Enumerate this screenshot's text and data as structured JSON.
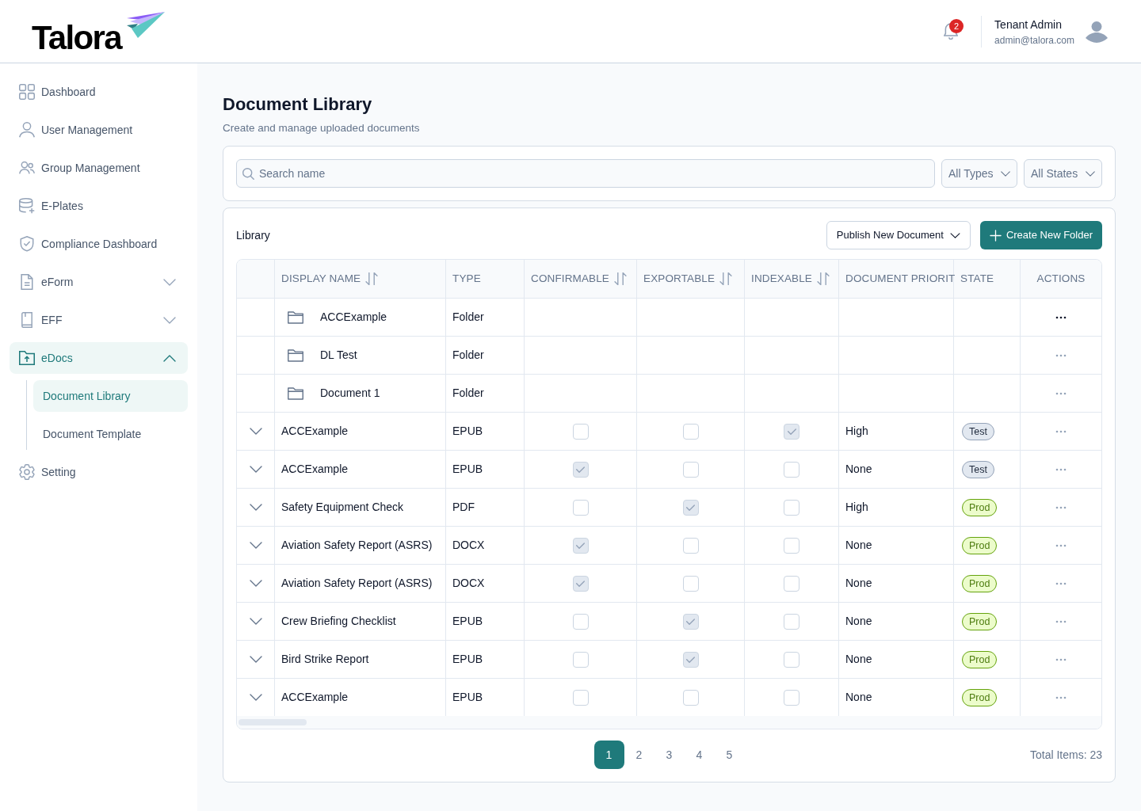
{
  "header": {
    "logo_text": "Talora",
    "notifications": {
      "count": "2"
    },
    "user": {
      "name": "Tenant Admin",
      "email": "admin@talora.com"
    }
  },
  "sidebar": {
    "items": [
      {
        "label": "Dashboard",
        "selected": false
      },
      {
        "label": "User Management",
        "selected": false
      },
      {
        "label": "Group Management",
        "selected": false
      },
      {
        "label": "E-Plates",
        "selected": false
      },
      {
        "label": "Compliance Dashboard",
        "selected": false
      },
      {
        "label": "eForm",
        "selected": false,
        "expanded": false
      },
      {
        "label": "EFF",
        "selected": false,
        "expanded": false
      },
      {
        "label": "eDocs",
        "selected": true,
        "expanded": true,
        "children": [
          {
            "label": "Document Library",
            "selected": true
          },
          {
            "label": "Document Template",
            "selected": false
          }
        ]
      },
      {
        "label": "Setting",
        "selected": false
      }
    ]
  },
  "page": {
    "title": "Document Library",
    "subtitle": "Create and manage uploaded documents"
  },
  "filters": {
    "search": {
      "placeholder": "Search name"
    },
    "type_select": {
      "value": "All Types"
    },
    "state_select": {
      "value": "All States"
    }
  },
  "library": {
    "title": "Library",
    "buttons": [
      {
        "label": "Publish New Document",
        "kind": "dropdown"
      },
      {
        "label": "Create New Folder",
        "kind": "primary"
      }
    ],
    "table": {
      "columns": [
        {
          "label": "DISPLAY NAME",
          "sortable": true
        },
        {
          "label": "TYPE",
          "sortable": false
        },
        {
          "label": "CONFIRMABLE",
          "sortable": true
        },
        {
          "label": "EXPORTABLE",
          "sortable": true
        },
        {
          "label": "INDEXABLE",
          "sortable": true
        },
        {
          "label": "DOCUMENT PRIORIT",
          "sortable": false
        },
        {
          "label": "STATE",
          "sortable": false
        },
        {
          "label": "ACTIONS",
          "sortable": false
        }
      ],
      "rows": [
        {
          "kind": "folder",
          "name": "ACCExample",
          "type": "Folder",
          "menu_active": true
        },
        {
          "kind": "folder",
          "name": "DL Test",
          "type": "Folder",
          "menu_active": false
        },
        {
          "kind": "folder",
          "name": "Document 1",
          "type": "Folder",
          "menu_active": false
        },
        {
          "kind": "document",
          "expanded": false,
          "name": "ACCExample",
          "type": "EPUB",
          "confirmable": false,
          "exportable": false,
          "indexable": true,
          "priority": "High",
          "state": {
            "label": "Test",
            "kind": "test"
          },
          "menu_active": false
        },
        {
          "kind": "document",
          "expanded": false,
          "name": "ACCExample",
          "type": "EPUB",
          "confirmable": true,
          "exportable": false,
          "indexable": false,
          "priority": "None",
          "state": {
            "label": "Test",
            "kind": "test"
          },
          "menu_active": false
        },
        {
          "kind": "document",
          "expanded": false,
          "name": "Safety Equipment Check",
          "type": "PDF",
          "confirmable": false,
          "exportable": true,
          "indexable": false,
          "priority": "High",
          "state": {
            "label": "Prod",
            "kind": "prod"
          },
          "menu_active": false
        },
        {
          "kind": "document",
          "expanded": false,
          "name": "Aviation Safety Report (ASRS)",
          "type": "DOCX",
          "confirmable": true,
          "exportable": false,
          "indexable": false,
          "priority": "None",
          "state": {
            "label": "Prod",
            "kind": "prod"
          },
          "menu_active": false
        },
        {
          "kind": "document",
          "expanded": false,
          "name": "Aviation Safety Report (ASRS)",
          "type": "DOCX",
          "confirmable": true,
          "exportable": false,
          "indexable": false,
          "priority": "None",
          "state": {
            "label": "Prod",
            "kind": "prod"
          },
          "menu_active": false
        },
        {
          "kind": "document",
          "expanded": false,
          "name": "Crew Briefing Checklist",
          "type": "EPUB",
          "confirmable": false,
          "exportable": true,
          "indexable": false,
          "priority": "None",
          "state": {
            "label": "Prod",
            "kind": "prod"
          },
          "menu_active": false
        },
        {
          "kind": "document",
          "expanded": false,
          "name": "Bird Strike Report",
          "type": "EPUB",
          "confirmable": false,
          "exportable": true,
          "indexable": false,
          "priority": "None",
          "state": {
            "label": "Prod",
            "kind": "prod"
          },
          "menu_active": false
        },
        {
          "kind": "document",
          "expanded": false,
          "name": "ACCExample",
          "type": "EPUB",
          "confirmable": false,
          "exportable": false,
          "indexable": false,
          "priority": "None",
          "state": {
            "label": "Prod",
            "kind": "prod"
          },
          "menu_active": false
        }
      ]
    },
    "pagination": {
      "pages": [
        {
          "label": "1",
          "selected": true
        },
        {
          "label": "2",
          "selected": false
        },
        {
          "label": "3",
          "selected": false
        },
        {
          "label": "4",
          "selected": false
        },
        {
          "label": "5",
          "selected": false
        }
      ],
      "total": "Total Items: 23"
    }
  }
}
